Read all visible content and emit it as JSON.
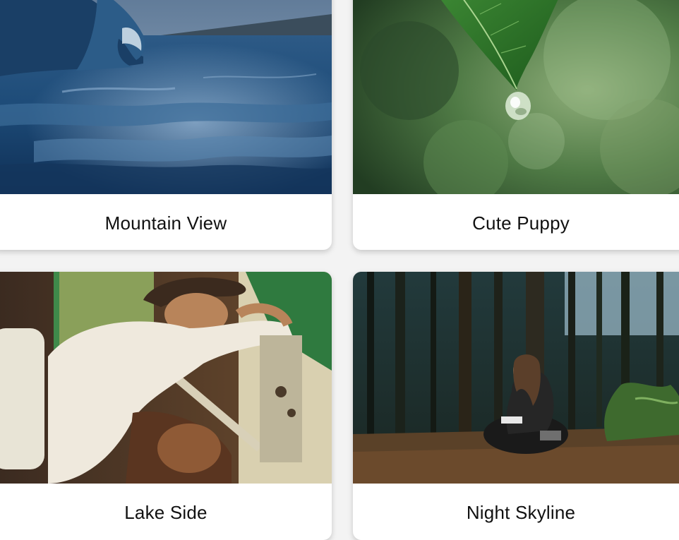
{
  "gallery": {
    "cards": [
      {
        "title": "Mountain View",
        "image": "ocean-wave-photo"
      },
      {
        "title": "Cute Puppy",
        "image": "leaf-water-drop-photo"
      },
      {
        "title": "Lake Side",
        "image": "man-in-hat-vintage-car-photo"
      },
      {
        "title": "Night Skyline",
        "image": "girl-reading-in-forest-photo"
      }
    ]
  },
  "colors": {
    "page_background": "#f3f3f3",
    "card_background": "#ffffff",
    "caption_text": "#111111"
  }
}
